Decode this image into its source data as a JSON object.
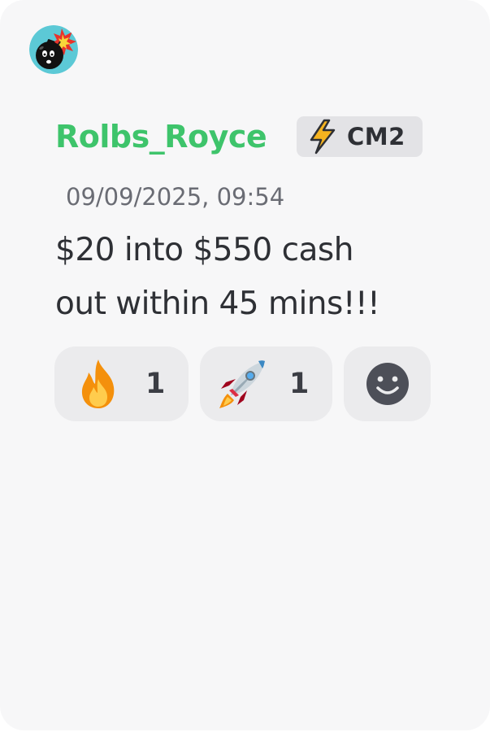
{
  "message": {
    "author": {
      "username": "Rolbs_Royce",
      "username_color": "#3ec46b",
      "avatar_icon": "bomb-avatar-icon",
      "tag": {
        "icon": "lightning-bolt-icon",
        "label": "CM2"
      }
    },
    "timestamp": "09/09/2025, 09:54",
    "text_line1": "$20 into $550 cash",
    "text_line2": "out within 45 mins!!!",
    "reactions": [
      {
        "emoji": "fire-emoji-icon",
        "count": "1"
      },
      {
        "emoji": "rocket-emoji-icon",
        "count": "1"
      }
    ],
    "add_reaction_icon": "smiley-add-reaction-icon"
  }
}
